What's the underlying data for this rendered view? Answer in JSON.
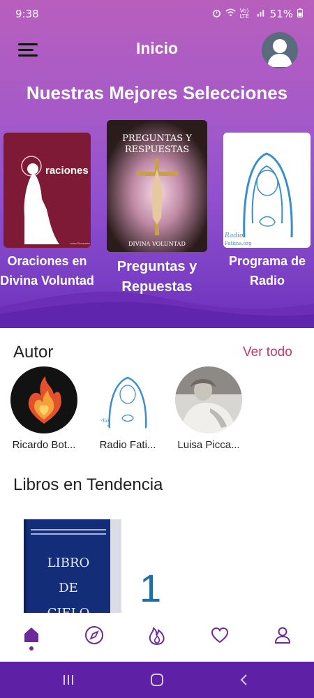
{
  "status_bar": {
    "time": "9:38",
    "signal_label": "Vo) LTE",
    "battery": "51%"
  },
  "app_bar": {
    "title": "Inicio"
  },
  "featured": {
    "heading": "Nuestras Mejores Selecciones",
    "items": [
      {
        "label": "Oraciones en Divina Voluntad",
        "cover_text": "raciones",
        "cover_small": "Luisa Piccarreta"
      },
      {
        "label": "Preguntas y Repuestas",
        "cover_title_line1": "PREGUNTAS Y",
        "cover_title_line2": "RESPUESTAS",
        "cover_footer": "DIVINA VOLUNTAD"
      },
      {
        "label": "Programa de Radio",
        "cover_text_line1": "Radio",
        "cover_text_line2": "Fatima.org"
      }
    ]
  },
  "authors": {
    "heading": "Autor",
    "see_all": "Ver todo",
    "items": [
      {
        "name": "Ricardo Bot..."
      },
      {
        "name": "Radio Fati...",
        "cover_text_line1": "adio",
        "cover_text_line2": "tima"
      },
      {
        "name": "Luisa Picca..."
      }
    ]
  },
  "trending": {
    "heading": "Libros en Tendencia",
    "books": [
      {
        "rank": "1",
        "cover_line1": "LIBRO",
        "cover_line2": "DE",
        "cover_line3": "CIELO"
      }
    ]
  },
  "bottom_nav": {
    "active": "home",
    "items": [
      "home-icon",
      "compass-icon",
      "flame-icon",
      "heart-icon",
      "user-icon"
    ]
  },
  "colors": {
    "accent": "#6b2a97",
    "link": "#c0396b",
    "system_bar": "#5e21a6",
    "hero_top": "#b85fbe",
    "hero_bottom": "#6a2fb8"
  }
}
